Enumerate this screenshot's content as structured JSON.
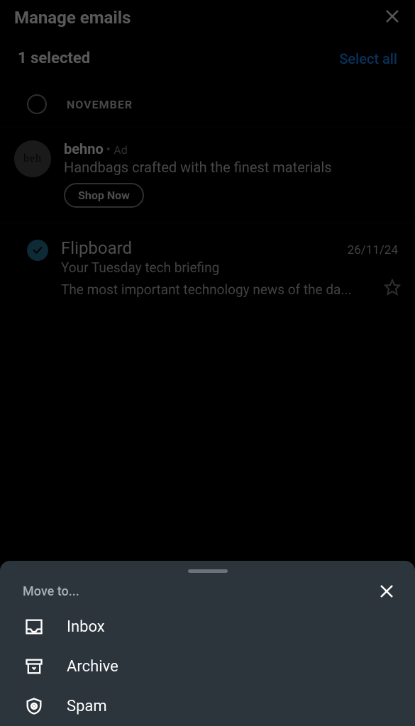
{
  "header": {
    "title": "Manage emails"
  },
  "subheader": {
    "selectedText": "1 selected",
    "selectAll": "Select all"
  },
  "dateLabel": "NOVEMBER",
  "ad": {
    "advertiser": "behno",
    "tag": "Ad",
    "text": "Handbags crafted with the finest materials",
    "button": "Shop Now",
    "avatarText": "beh"
  },
  "email": {
    "sender": "Flipboard",
    "date": "26/11/24",
    "subject": "Your Tuesday tech briefing",
    "preview": "The most important technology news of the da..."
  },
  "sheet": {
    "title": "Move to...",
    "items": [
      {
        "label": "Inbox"
      },
      {
        "label": "Archive"
      },
      {
        "label": "Spam"
      }
    ]
  }
}
